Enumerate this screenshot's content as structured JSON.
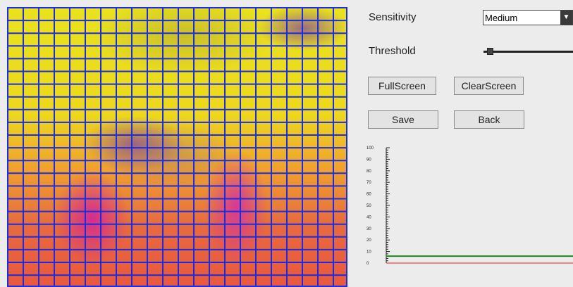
{
  "controls": {
    "sensitivity_label": "Sensitivity",
    "sensitivity_value": "Medium",
    "threshold_label": "Threshold",
    "threshold_level": 0.06
  },
  "buttons": {
    "fullscreen": "FullScreen",
    "clearscreen": "ClearScreen",
    "save": "Save",
    "back": "Back"
  },
  "grid": {
    "columns": 22,
    "rows": 22,
    "line_color": "#1a2ee0"
  },
  "chart_data": {
    "type": "line",
    "ylim": [
      0,
      100
    ],
    "yticks": [
      "100",
      "90",
      "80",
      "70",
      "60",
      "50",
      "40",
      "30",
      "20",
      "10",
      "0"
    ],
    "series": [
      {
        "color": "#1a8a1a",
        "values": [
          6,
          6
        ]
      },
      {
        "color": "#e02020",
        "values": [
          0,
          0
        ]
      }
    ]
  }
}
